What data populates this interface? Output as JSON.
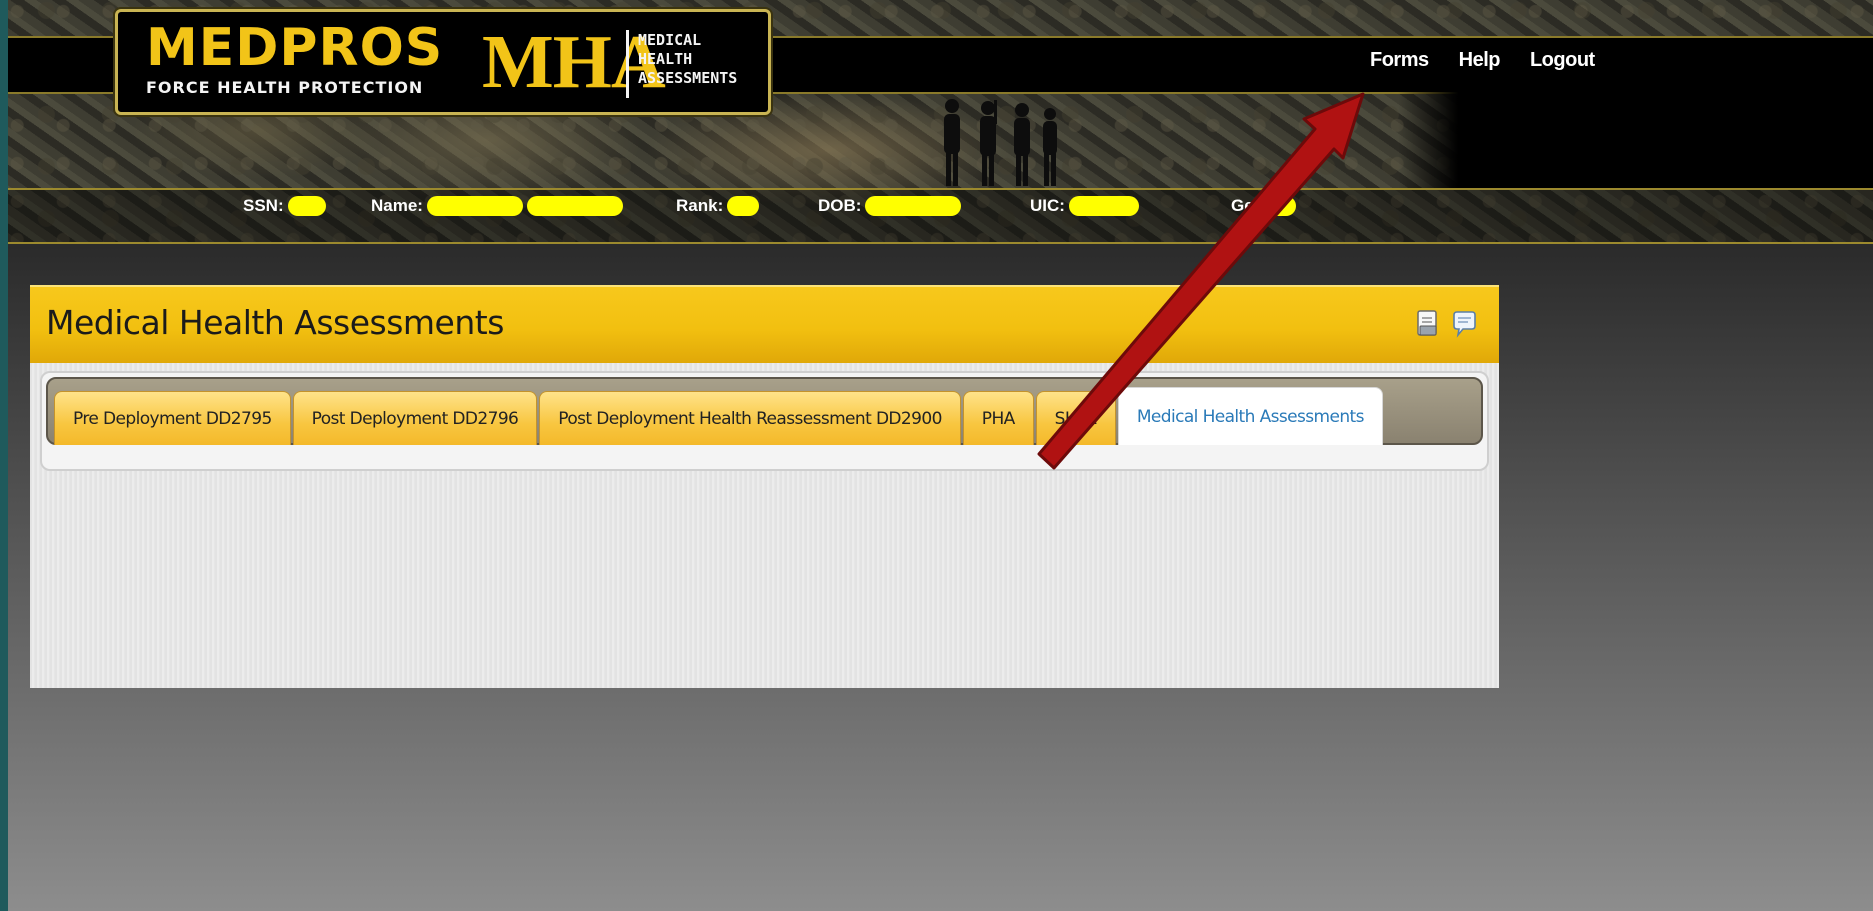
{
  "header": {
    "logo": {
      "brand": "MEDPROS",
      "tagline": "FORCE HEALTH PROTECTION",
      "product": "MHA",
      "product_lines": [
        "MEDICAL",
        "HEALTH",
        "ASSESSMENTS"
      ]
    },
    "nav": {
      "forms": "Forms",
      "help": "Help",
      "logout": "Logout"
    },
    "info_fields": {
      "ssn_label": "SSN:",
      "name_label": "Name:",
      "rank_label": "Rank:",
      "dob_label": "DOB:",
      "uic_label": "UIC:",
      "gender_label": "Ge"
    }
  },
  "panel": {
    "title": "Medical Health Assessments",
    "icons": [
      "print-icon",
      "comment-icon"
    ],
    "tabs": [
      {
        "label": "Pre Deployment DD2795",
        "active": false
      },
      {
        "label": "Post Deployment DD2796",
        "active": false
      },
      {
        "label": "Post Deployment Health Reassessment DD2900",
        "active": false
      },
      {
        "label": "PHA",
        "active": false
      },
      {
        "label": "SHPE",
        "active": false
      },
      {
        "label": "Medical Health Assessments",
        "active": true
      }
    ]
  },
  "colors": {
    "accent_yellow": "#f2c418",
    "active_tab_text": "#2a7ab8",
    "annotation_arrow": "#b01212",
    "redaction": "#ffff00"
  }
}
